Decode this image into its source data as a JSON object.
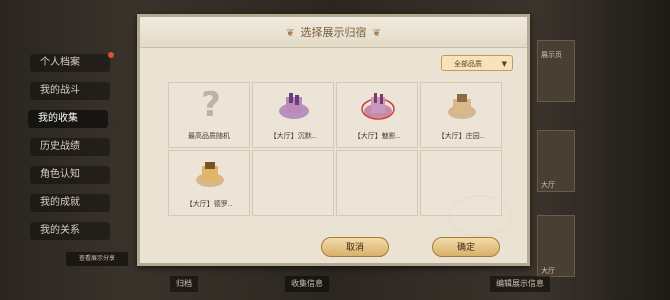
{
  "sidebar": {
    "items": [
      {
        "label": "个人档案",
        "active": false,
        "badge": true
      },
      {
        "label": "我的战斗",
        "active": false,
        "badge": false
      },
      {
        "label": "我的收集",
        "active": true,
        "badge": false
      },
      {
        "label": "历史战绩",
        "active": false,
        "badge": false
      },
      {
        "label": "角色认知",
        "active": false,
        "badge": false
      },
      {
        "label": "我的成就",
        "active": false,
        "badge": false
      },
      {
        "label": "我的关系",
        "active": false,
        "badge": false
      }
    ],
    "corner_button": "查看展示分享"
  },
  "background": {
    "right_labels": [
      "展示页",
      "大厅",
      "大厅"
    ],
    "bottom_tabs": [
      "归档",
      "收集信息",
      "编辑展示信息"
    ]
  },
  "dialog": {
    "title": "选择展示归宿",
    "filter_label": "全部品质",
    "slots": [
      {
        "label": "最高品质随机",
        "type": "random"
      },
      {
        "label": "【大厅】沉默..",
        "type": "item",
        "accent": "#8a4fa6"
      },
      {
        "label": "【大厅】魅影..",
        "type": "item",
        "accent": "#a63f7c",
        "selected": true
      },
      {
        "label": "【大厅】庄园..",
        "type": "item",
        "accent": "#b8894f"
      },
      {
        "label": "【大厅】德罗..",
        "type": "item",
        "accent": "#c58a3a"
      },
      {
        "label": "",
        "type": "empty"
      },
      {
        "label": "",
        "type": "empty"
      },
      {
        "label": "",
        "type": "empty"
      }
    ],
    "cancel_label": "取消",
    "confirm_label": "确定"
  }
}
